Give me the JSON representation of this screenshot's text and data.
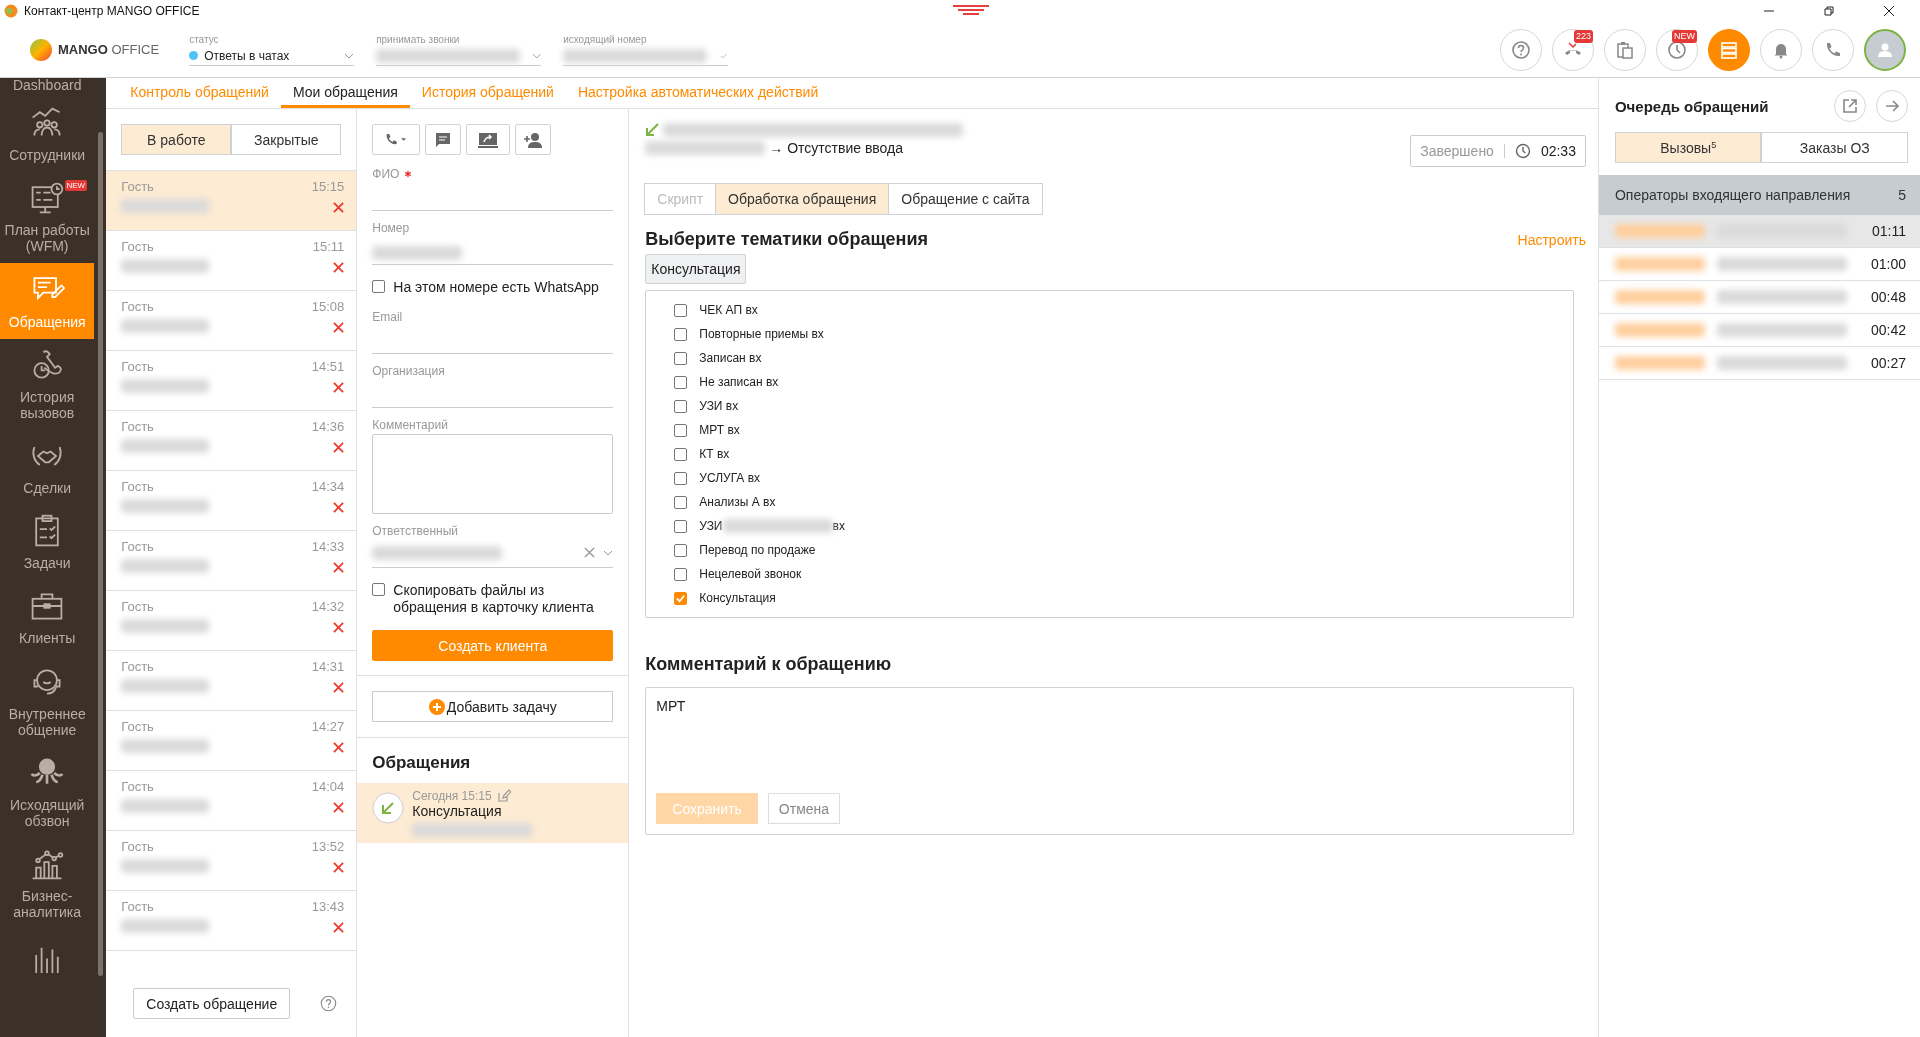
{
  "window": {
    "title": "Контакт-центр MANGO OFFICE"
  },
  "header": {
    "logo_bold": "MANGO",
    "logo_light": "OFFICE",
    "status": {
      "label": "статус",
      "value": "Ответы в чатах",
      "color": "#4fc3f7"
    },
    "accept_calls": {
      "label": "принимать звонки"
    },
    "outgoing_number": {
      "label": "исходящий номер"
    },
    "toolbar": [
      {
        "kind": "help",
        "selected": false
      },
      {
        "kind": "missed",
        "badge": "223",
        "selected": false
      },
      {
        "kind": "clipboard",
        "selected": false
      },
      {
        "kind": "clock",
        "badge": "NEW",
        "selected": false
      },
      {
        "kind": "queue",
        "selected": true
      },
      {
        "kind": "bell",
        "selected": false
      },
      {
        "kind": "phone",
        "selected": false
      },
      {
        "kind": "avatar",
        "selected": false
      }
    ]
  },
  "sidebar": {
    "items": [
      {
        "label": "Dashboard",
        "selected": false
      },
      {
        "label": "Сотрудники",
        "selected": false
      },
      {
        "label": "План работы (WFM)",
        "badge": "NEW",
        "selected": false
      },
      {
        "label": "Обращения",
        "selected": true
      },
      {
        "label": "История вызовов",
        "selected": false
      },
      {
        "label": "Сделки",
        "selected": false
      },
      {
        "label": "Задачи",
        "selected": false
      },
      {
        "label": "Клиенты",
        "selected": false
      },
      {
        "label": "Внутреннее общение",
        "selected": false
      },
      {
        "label": "Исходящий обзвон",
        "selected": false
      },
      {
        "label": "Бизнес-аналитика",
        "selected": false
      },
      {
        "selected": false
      }
    ]
  },
  "tabs": [
    {
      "label": "Контроль обращений",
      "selected": false
    },
    {
      "label": "Мои обращения",
      "selected": true
    },
    {
      "label": "История обращений",
      "selected": false
    },
    {
      "label": "Настройка автоматических действий",
      "selected": false
    }
  ],
  "list": {
    "filters": [
      {
        "label": "В работе",
        "selected": true
      },
      {
        "label": "Закрытые",
        "selected": false
      }
    ],
    "items": [
      {
        "name": "Гость",
        "time": "15:15",
        "selected": true
      },
      {
        "name": "Гость",
        "time": "15:11",
        "selected": false
      },
      {
        "name": "Гость",
        "time": "15:08",
        "selected": false
      },
      {
        "name": "Гость",
        "time": "14:51",
        "selected": false
      },
      {
        "name": "Гость",
        "time": "14:36",
        "selected": false
      },
      {
        "name": "Гость",
        "time": "14:34",
        "selected": false
      },
      {
        "name": "Гость",
        "time": "14:33",
        "selected": false
      },
      {
        "name": "Гость",
        "time": "14:32",
        "selected": false
      },
      {
        "name": "Гость",
        "time": "14:31",
        "selected": false
      },
      {
        "name": "Гость",
        "time": "14:27",
        "selected": false
      },
      {
        "name": "Гость",
        "time": "14:04",
        "selected": false
      },
      {
        "name": "Гость",
        "time": "13:52",
        "selected": false
      },
      {
        "name": "Гость",
        "time": "13:43",
        "selected": false
      }
    ],
    "create_button": "Создать обращение"
  },
  "form": {
    "fields": [
      {
        "kind": "text",
        "label": "ФИО",
        "required": true
      },
      {
        "kind": "text",
        "label": "Номер",
        "required": false
      },
      {
        "kind": "checkbox",
        "label": "На этом номере есть WhatsApp",
        "checked": false
      },
      {
        "kind": "text",
        "label": "Email",
        "required": false
      },
      {
        "kind": "text",
        "label": "Организация",
        "required": false
      },
      {
        "kind": "textarea",
        "label": "Комментарий"
      },
      {
        "kind": "select",
        "label": "Ответственный"
      },
      {
        "kind": "checkbox",
        "label": "Скопировать файлы из обращения в карточку клиента",
        "checked": false
      }
    ],
    "create_client": "Создать клиента",
    "add_task": "Добавить задачу",
    "history_title": "Обращения",
    "history": [
      {
        "date": "Сегодня 15:15",
        "topic": "Консультация",
        "selected": true
      }
    ]
  },
  "detail": {
    "route": "→ Отсутствие ввода",
    "status": "Завершено",
    "duration": "02:33",
    "tabs": [
      {
        "label": "Скрипт",
        "disabled": true,
        "selected": false
      },
      {
        "label": "Обработка обращения",
        "disabled": false,
        "selected": true
      },
      {
        "label": "Обращение с сайта",
        "disabled": false,
        "selected": false
      }
    ],
    "topics_title": "Выберите тематики обращения",
    "configure": "Настроить",
    "chosen": [
      "Консультация"
    ],
    "topics": [
      {
        "label": "ЧЕК АП вх",
        "checked": false
      },
      {
        "label": "Повторные приемы вх",
        "checked": false
      },
      {
        "label": "Записан вх",
        "checked": false
      },
      {
        "label": "Не записан вх",
        "checked": false
      },
      {
        "label": "УЗИ вх",
        "checked": false
      },
      {
        "label": "МРТ вх",
        "checked": false
      },
      {
        "label": "КТ вх",
        "checked": false
      },
      {
        "label": "УСЛУГА вх",
        "checked": false
      },
      {
        "label": "Анализы А вх",
        "checked": false
      },
      {
        "label": "УЗИ",
        "suffix": "вх",
        "checked": false
      },
      {
        "label": "Перевод по продаже",
        "checked": false
      },
      {
        "label": "Нецелевой звонок",
        "checked": false
      },
      {
        "label": "Консультация",
        "checked": true
      }
    ],
    "comment_title": "Комментарий к обращению",
    "comment": "МРТ",
    "save": {
      "label": "Сохранить",
      "disabled": true
    },
    "cancel": "Отмена"
  },
  "queue": {
    "title": "Очередь обращений",
    "tabs": [
      {
        "label": "Вызовы",
        "count": "5",
        "selected": true
      },
      {
        "label": "Заказы ОЗ",
        "selected": false
      }
    ],
    "group": {
      "name": "Операторы входящего направления",
      "count": "5"
    },
    "items": [
      {
        "time": "01:11",
        "selected": true
      },
      {
        "time": "01:00",
        "selected": false
      },
      {
        "time": "00:48",
        "selected": false
      },
      {
        "time": "00:42",
        "selected": false
      },
      {
        "time": "00:27",
        "selected": false
      }
    ]
  }
}
